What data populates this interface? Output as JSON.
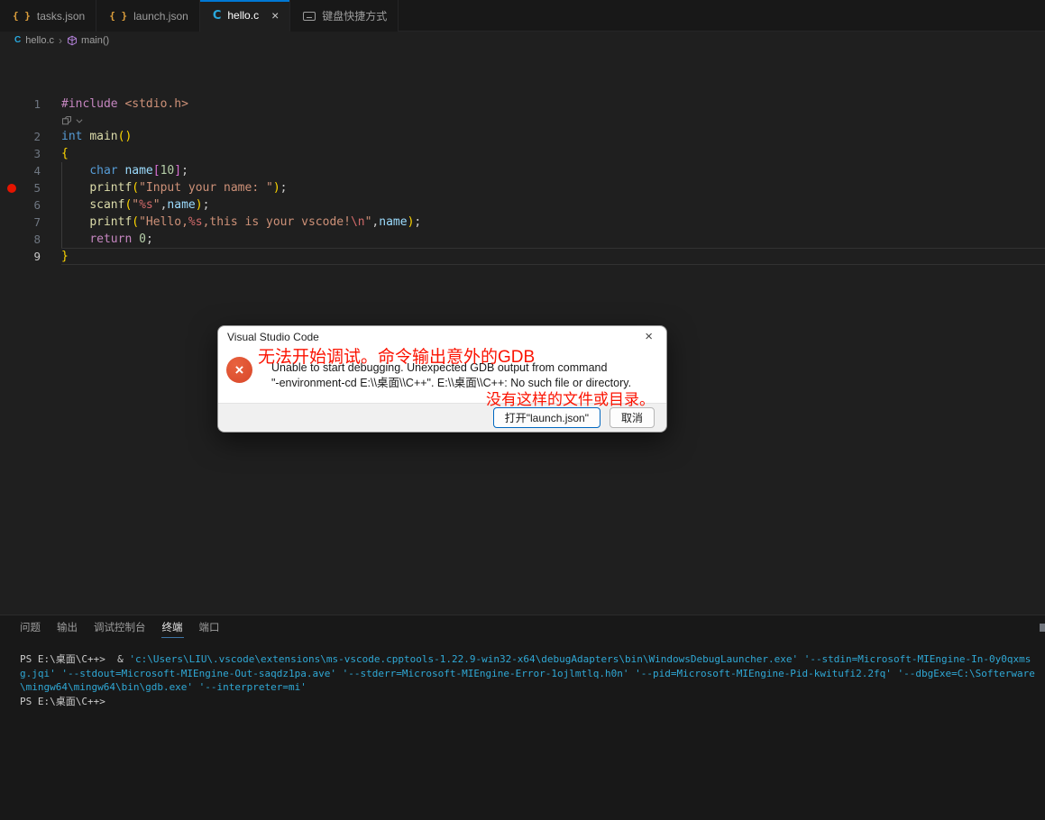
{
  "colors": {
    "accent_tab_border": "#0078d4",
    "breakpoint_red": "#e51400",
    "error_icon": "#d9472a",
    "annotation_red": "#fb1200",
    "terminal_command_cyan": "#2fa8d5",
    "panel_active_underline": "#3d74a3",
    "editor_background": "#1f1f1f",
    "panel_background": "#181818"
  },
  "tabs": [
    {
      "label": "tasks.json",
      "icon": "json-braces-icon",
      "active": false
    },
    {
      "label": "launch.json",
      "icon": "json-braces-icon",
      "active": false
    },
    {
      "label": "hello.c",
      "icon": "c-file-icon",
      "active": true,
      "close_glyph": "×"
    },
    {
      "label": "键盘快捷方式",
      "icon": "keyboard-icon",
      "active": false
    }
  ],
  "breadcrumb": {
    "file": "hello.c",
    "separator": "›",
    "symbol": "main()"
  },
  "editor": {
    "breakpoint_line": 5,
    "active_line": 9,
    "lines": [
      {
        "num": 1,
        "action_after": true,
        "tokens": [
          [
            "pre",
            "#include"
          ],
          [
            "pun",
            " "
          ],
          [
            "str",
            "<stdio.h>"
          ]
        ]
      },
      {
        "num": 2,
        "tokens": [
          [
            "kw",
            "int"
          ],
          [
            "pun",
            " "
          ],
          [
            "fn",
            "main"
          ],
          [
            "b1",
            "()"
          ]
        ]
      },
      {
        "num": 3,
        "tokens": [
          [
            "b1",
            "{"
          ]
        ]
      },
      {
        "num": 4,
        "tokens": [
          [
            "pun",
            "    "
          ],
          [
            "kw",
            "char"
          ],
          [
            "pun",
            " "
          ],
          [
            "var",
            "name"
          ],
          [
            "b2",
            "["
          ],
          [
            "num",
            "10"
          ],
          [
            "b2",
            "]"
          ],
          [
            "pun",
            ";"
          ]
        ]
      },
      {
        "num": 5,
        "tokens": [
          [
            "pun",
            "    "
          ],
          [
            "fn",
            "printf"
          ],
          [
            "b1",
            "("
          ],
          [
            "str",
            "\"Input your name: \""
          ],
          [
            "b1",
            ")"
          ],
          [
            "pun",
            ";"
          ]
        ]
      },
      {
        "num": 6,
        "tokens": [
          [
            "pun",
            "    "
          ],
          [
            "fn",
            "scanf"
          ],
          [
            "b1",
            "("
          ],
          [
            "str",
            "\""
          ],
          [
            "fmt",
            "%s"
          ],
          [
            "str",
            "\""
          ],
          [
            "pun",
            ","
          ],
          [
            "var",
            "name"
          ],
          [
            "b1",
            ")"
          ],
          [
            "pun",
            ";"
          ]
        ]
      },
      {
        "num": 7,
        "tokens": [
          [
            "pun",
            "    "
          ],
          [
            "fn",
            "printf"
          ],
          [
            "b1",
            "("
          ],
          [
            "str",
            "\"Hello,"
          ],
          [
            "fmt",
            "%s"
          ],
          [
            "str",
            ",this is your vscode!"
          ],
          [
            "fmt",
            "\\n"
          ],
          [
            "str",
            "\""
          ],
          [
            "pun",
            ","
          ],
          [
            "var",
            "name"
          ],
          [
            "b1",
            ")"
          ],
          [
            "pun",
            ";"
          ]
        ]
      },
      {
        "num": 8,
        "tokens": [
          [
            "pun",
            "    "
          ],
          [
            "pre",
            "return"
          ],
          [
            "pun",
            " "
          ],
          [
            "num",
            "0"
          ],
          [
            "pun",
            ";"
          ]
        ]
      },
      {
        "num": 9,
        "tokens": [
          [
            "b1",
            "}"
          ]
        ]
      }
    ]
  },
  "dialog": {
    "title": "Visual Studio Code",
    "close_glyph": "×",
    "error_icon_glyph": "×",
    "message_line1": "Unable to start debugging. Unexpected GDB output from command",
    "message_line2": "\"-environment-cd E:\\\\桌面\\\\C++\". E:\\\\桌面\\\\C++: No such file or directory.",
    "annotation_top": "无法开始调试。命令输出意外的GDB",
    "annotation_bottom": "没有这样的文件或目录。",
    "buttons": [
      {
        "label": "打开\"launch.json\"",
        "primary": true
      },
      {
        "label": "取消",
        "primary": false
      }
    ]
  },
  "panel": {
    "tabs": [
      {
        "label": "问题",
        "active": false
      },
      {
        "label": "输出",
        "active": false
      },
      {
        "label": "调试控制台",
        "active": false
      },
      {
        "label": "终端",
        "active": true
      },
      {
        "label": "端口",
        "active": false
      }
    ]
  },
  "terminal": {
    "lines": [
      {
        "segments": [
          [
            "p",
            "PS E:\\桌面\\C++>  & "
          ],
          [
            "c",
            "'c:\\Users\\LIU\\.vscode\\extensions\\ms-vscode.cpptools-1.22.9-win32-x64\\debugAdapters\\bin\\WindowsDebugLauncher.exe' '--stdin=Microsoft-MIEngine-In-0y0qxms"
          ]
        ]
      },
      {
        "segments": [
          [
            "c",
            "g.jqi' '--stdout=Microsoft-MIEngine-Out-saqdz1pa.ave' '--stderr=Microsoft-MIEngine-Error-1ojlmtlq.h0n' '--pid=Microsoft-MIEngine-Pid-kwitufi2.2fq' '--dbgExe=C:\\Softerware"
          ]
        ]
      },
      {
        "segments": [
          [
            "c",
            "\\mingw64\\mingw64\\bin\\gdb.exe' '--interpreter=mi'"
          ]
        ]
      },
      {
        "segments": [
          [
            "p",
            "PS E:\\桌面\\C++>"
          ]
        ]
      }
    ]
  }
}
